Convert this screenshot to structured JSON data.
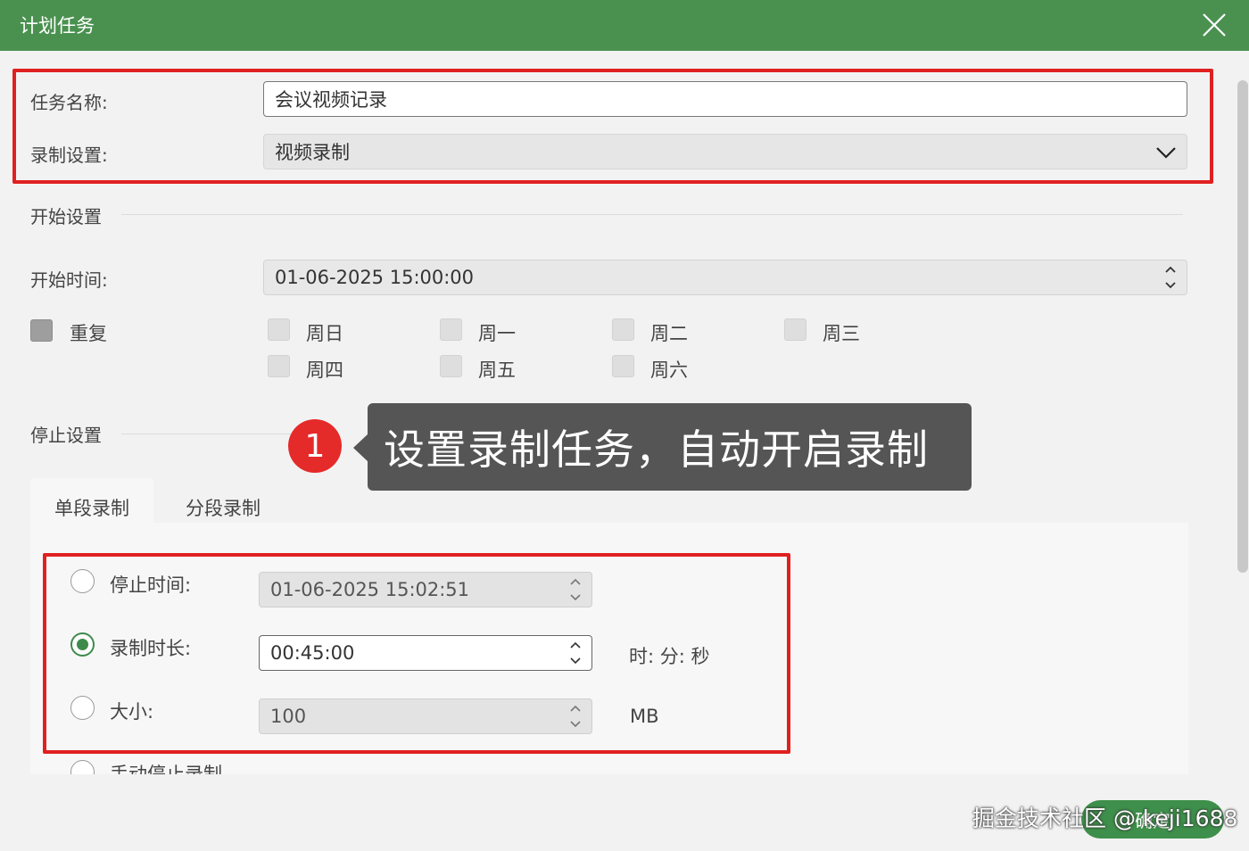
{
  "window": {
    "title": "计划任务"
  },
  "task": {
    "name_label": "任务名称:",
    "name_value": "会议视频记录",
    "record_label": "录制设置:",
    "record_value": "视频录制"
  },
  "start": {
    "section_title": "开始设置",
    "time_label": "开始时间:",
    "time_value": "01-06-2025 15:00:00",
    "repeat_label": "重复",
    "days": [
      "周日",
      "周一",
      "周二",
      "周三",
      "周四",
      "周五",
      "周六"
    ]
  },
  "stop": {
    "section_title": "停止设置",
    "tabs": [
      "单段录制",
      "分段录制"
    ],
    "stop_time_label": "停止时间:",
    "stop_time_value": "01-06-2025 15:02:51",
    "duration_label": "录制时长:",
    "duration_value": "00:45:00",
    "duration_unit": "时: 分: 秒",
    "size_label": "大小:",
    "size_value": "100",
    "size_unit": "MB",
    "manual_label": "手动停止录制"
  },
  "callout": {
    "number": "1",
    "text": "设置录制任务，自动开启录制"
  },
  "footer": {
    "confirm_label": "确定",
    "watermark": "掘金技术社区 @ keji1688"
  },
  "colors": {
    "titlebar": "#4a9150",
    "highlight": "#e02020",
    "accent": "#3e8a4a",
    "callout_bg": "#555555",
    "badge": "#e52a2a"
  }
}
